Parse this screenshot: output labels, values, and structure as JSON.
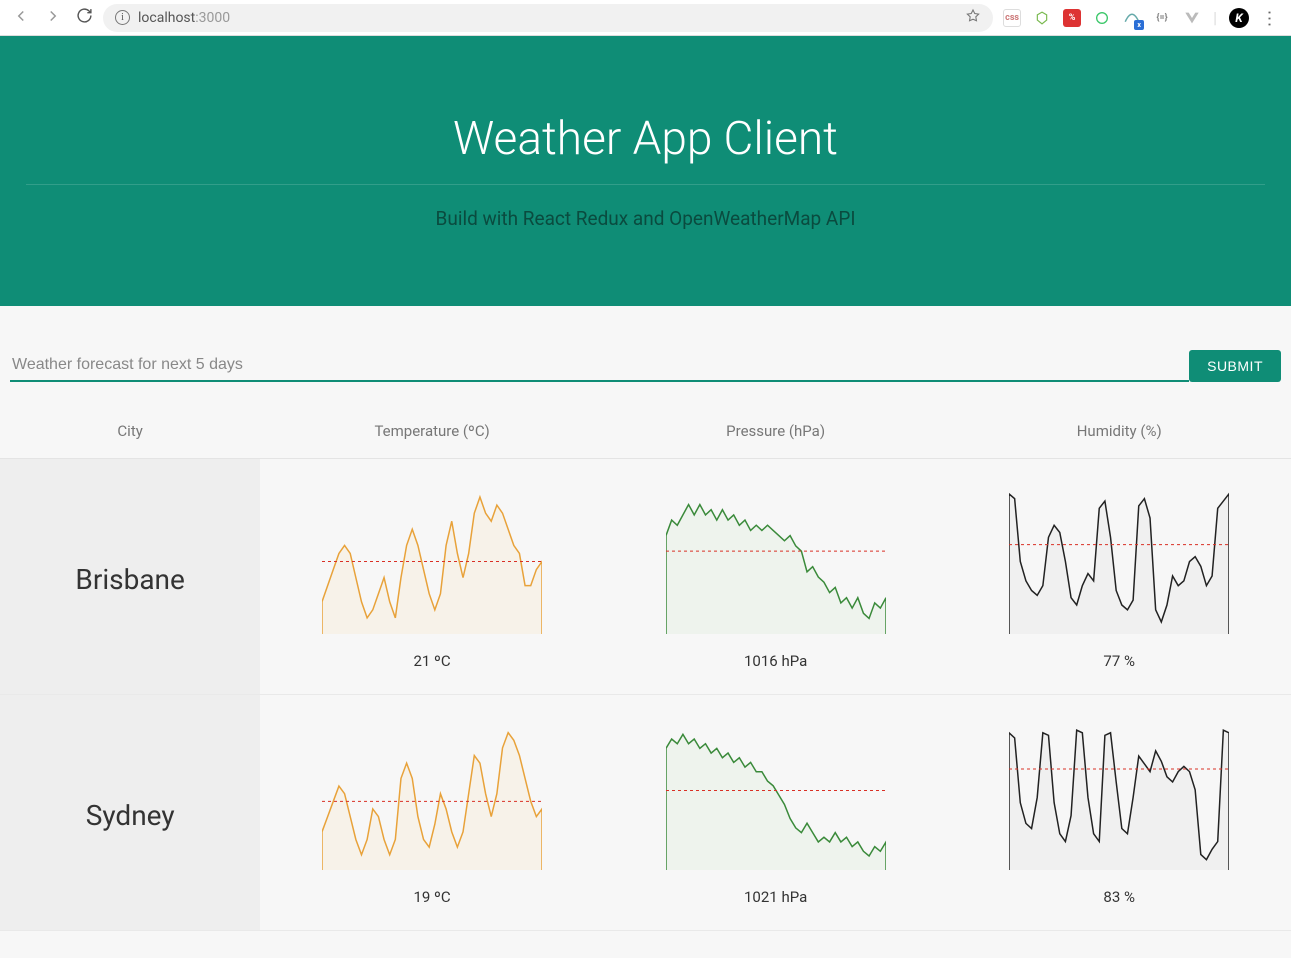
{
  "browser": {
    "url_host": "localhost",
    "url_port": ":3000",
    "icons": {
      "back": "back-arrow",
      "forward": "forward-arrow",
      "reload": "reload",
      "info": "i",
      "star": "star"
    },
    "extensions": [
      "css",
      "node",
      "red",
      "green",
      "tail",
      "brace",
      "vue",
      "k"
    ]
  },
  "hero": {
    "title": "Weather App Client",
    "subtitle": "Build with React Redux and OpenWeatherMap API"
  },
  "search": {
    "placeholder": "Weather forecast for next 5 days",
    "submit": "SUBMIT"
  },
  "columns": {
    "city": "City",
    "temp": "Temperature (ºC)",
    "pressure": "Pressure (hPa)",
    "humidity": "Humidity (%)"
  },
  "rows": [
    {
      "city": "Brisbane",
      "temp": {
        "avg_label": "21 ºC",
        "color": "#e8a23a",
        "fill": "#f7e3c0"
      },
      "pressure": {
        "avg_label": "1016 hPa",
        "color": "#3a8a3a",
        "fill": "#d3e8cf"
      },
      "humidity": {
        "avg_label": "77 %",
        "color": "#222",
        "fill": "#dcdcdc"
      }
    },
    {
      "city": "Sydney",
      "temp": {
        "avg_label": "19 ºC",
        "color": "#e8a23a",
        "fill": "#f7e3c0"
      },
      "pressure": {
        "avg_label": "1021 hPa",
        "color": "#3a8a3a",
        "fill": "#d3e8cf"
      },
      "humidity": {
        "avg_label": "83 %",
        "color": "#222",
        "fill": "#dcdcdc"
      }
    }
  ],
  "chart_data": [
    {
      "type": "area",
      "city": "Brisbane",
      "metric": "Temperature (ºC)",
      "x": [
        0,
        1,
        2,
        3,
        4,
        5,
        6,
        7,
        8,
        9,
        10,
        11,
        12,
        13,
        14,
        15,
        16,
        17,
        18,
        19,
        20,
        21,
        22,
        23,
        24,
        25,
        26,
        27,
        28,
        29,
        30,
        31,
        32,
        33,
        34,
        35,
        36,
        37,
        38,
        39
      ],
      "values": [
        16,
        18,
        20,
        22,
        23,
        22,
        19,
        16,
        14,
        15,
        17,
        19,
        16,
        14,
        19,
        23,
        25,
        23,
        20,
        17,
        15,
        17,
        23,
        26,
        22,
        19,
        22,
        27,
        29,
        27,
        26,
        28,
        27,
        25,
        23,
        22,
        18,
        18,
        20,
        21
      ],
      "mean": 21,
      "ylim": [
        12,
        30
      ]
    },
    {
      "type": "area",
      "city": "Brisbane",
      "metric": "Pressure (hPa)",
      "x": [
        0,
        1,
        2,
        3,
        4,
        5,
        6,
        7,
        8,
        9,
        10,
        11,
        12,
        13,
        14,
        15,
        16,
        17,
        18,
        19,
        20,
        21,
        22,
        23,
        24,
        25,
        26,
        27,
        28,
        29,
        30,
        31,
        32,
        33,
        34,
        35,
        36,
        37,
        38,
        39
      ],
      "values": [
        1019,
        1022,
        1021,
        1023,
        1025,
        1023,
        1025,
        1023,
        1024,
        1022,
        1024,
        1022,
        1023,
        1021,
        1022,
        1020,
        1021,
        1020,
        1021,
        1020,
        1019,
        1018,
        1019,
        1017,
        1016,
        1012,
        1013,
        1011,
        1010,
        1008,
        1009,
        1006,
        1007,
        1005,
        1007,
        1004,
        1003,
        1006,
        1005,
        1007
      ],
      "mean": 1016,
      "ylim": [
        1000,
        1028
      ]
    },
    {
      "type": "area",
      "city": "Brisbane",
      "metric": "Humidity (%)",
      "x": [
        0,
        1,
        2,
        3,
        4,
        5,
        6,
        7,
        8,
        9,
        10,
        11,
        12,
        13,
        14,
        15,
        16,
        17,
        18,
        19,
        20,
        21,
        22,
        23,
        24,
        25,
        26,
        27,
        28,
        29,
        30,
        31,
        32,
        33,
        34,
        35,
        36,
        37,
        38,
        39
      ],
      "values": [
        98,
        96,
        70,
        62,
        58,
        56,
        60,
        80,
        85,
        82,
        70,
        55,
        52,
        60,
        65,
        62,
        92,
        95,
        80,
        58,
        52,
        50,
        54,
        93,
        96,
        88,
        50,
        45,
        52,
        64,
        60,
        62,
        70,
        72,
        68,
        60,
        64,
        92,
        95,
        98
      ],
      "mean": 77,
      "ylim": [
        40,
        100
      ]
    },
    {
      "type": "area",
      "city": "Sydney",
      "metric": "Temperature (ºC)",
      "x": [
        0,
        1,
        2,
        3,
        4,
        5,
        6,
        7,
        8,
        9,
        10,
        11,
        12,
        13,
        14,
        15,
        16,
        17,
        18,
        19,
        20,
        21,
        22,
        23,
        24,
        25,
        26,
        27,
        28,
        29,
        30,
        31,
        32,
        33,
        34,
        35,
        36,
        37,
        38,
        39
      ],
      "values": [
        15,
        17,
        19,
        21,
        20,
        17,
        14,
        12,
        14,
        18,
        17,
        14,
        12,
        14,
        22,
        24,
        22,
        17,
        14,
        13,
        16,
        20,
        18,
        15,
        13,
        15,
        20,
        25,
        24,
        20,
        17,
        20,
        26,
        28,
        27,
        25,
        22,
        19,
        17,
        18
      ],
      "mean": 19,
      "ylim": [
        10,
        29
      ]
    },
    {
      "type": "area",
      "city": "Sydney",
      "metric": "Pressure (hPa)",
      "x": [
        0,
        1,
        2,
        3,
        4,
        5,
        6,
        7,
        8,
        9,
        10,
        11,
        12,
        13,
        14,
        15,
        16,
        17,
        18,
        19,
        20,
        21,
        22,
        23,
        24,
        25,
        26,
        27,
        28,
        29,
        30,
        31,
        32,
        33,
        34,
        35,
        36,
        37,
        38,
        39
      ],
      "values": [
        1030,
        1032,
        1031,
        1033,
        1031,
        1032,
        1030,
        1031,
        1029,
        1030,
        1028,
        1029,
        1027,
        1028,
        1026,
        1027,
        1025,
        1025,
        1023,
        1022,
        1020,
        1018,
        1015,
        1013,
        1012,
        1014,
        1012,
        1010,
        1011,
        1010,
        1012,
        1010,
        1011,
        1009,
        1010,
        1008,
        1007,
        1009,
        1008,
        1010
      ],
      "mean": 1021,
      "ylim": [
        1004,
        1035
      ]
    },
    {
      "type": "area",
      "city": "Sydney",
      "metric": "Humidity (%)",
      "x": [
        0,
        1,
        2,
        3,
        4,
        5,
        6,
        7,
        8,
        9,
        10,
        11,
        12,
        13,
        14,
        15,
        16,
        17,
        18,
        19,
        20,
        21,
        22,
        23,
        24,
        25,
        26,
        27,
        28,
        29,
        30,
        31,
        32,
        33,
        34,
        35,
        36,
        37,
        38,
        39
      ],
      "values": [
        97,
        95,
        70,
        62,
        60,
        72,
        97,
        96,
        70,
        58,
        55,
        65,
        98,
        97,
        72,
        58,
        55,
        96,
        97,
        78,
        60,
        58,
        72,
        88,
        85,
        82,
        90,
        86,
        80,
        78,
        82,
        84,
        82,
        75,
        50,
        48,
        52,
        55,
        98,
        97
      ],
      "mean": 83,
      "ylim": [
        44,
        100
      ]
    }
  ]
}
